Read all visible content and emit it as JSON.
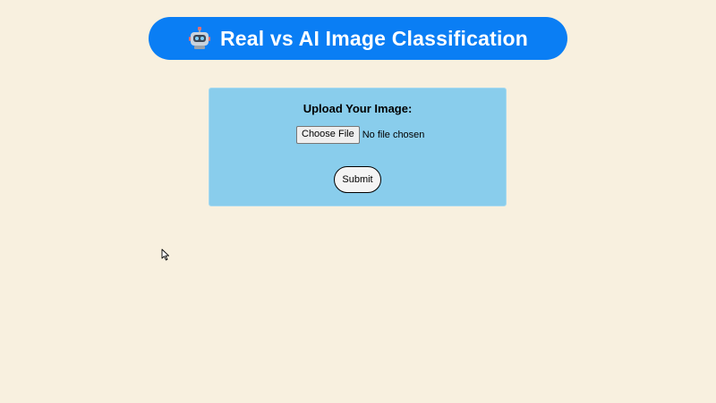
{
  "header": {
    "title": "Real vs AI Image Classification",
    "icon": "robot-icon",
    "background": "#0a7ef4"
  },
  "upload_form": {
    "label": "Upload Your Image:",
    "file_button_label": "Choose File",
    "file_status": "No file chosen",
    "submit_label": "Submit",
    "background": "#89cdec"
  },
  "page": {
    "background": "#f8f0df"
  },
  "cursor": "arrow-cursor-icon"
}
